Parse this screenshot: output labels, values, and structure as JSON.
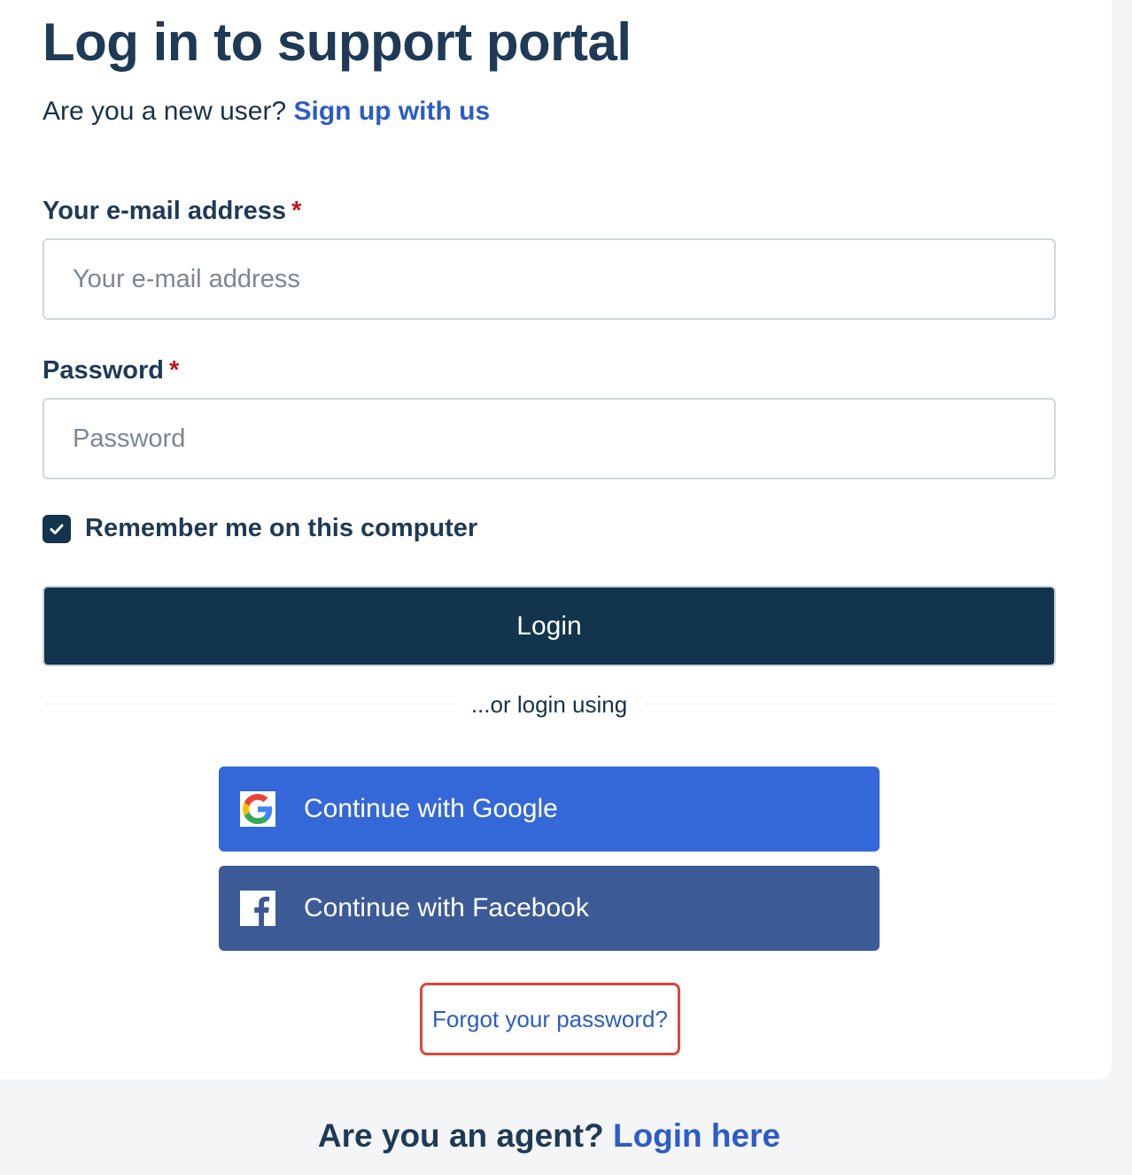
{
  "page": {
    "title": "Log in to support portal",
    "signup_prompt": "Are you a new user?",
    "signup_link": "Sign up with us"
  },
  "form": {
    "email": {
      "label": "Your e-mail address",
      "required_marker": "*",
      "placeholder": "Your e-mail address",
      "value": ""
    },
    "password": {
      "label": "Password",
      "required_marker": "*",
      "placeholder": "Password",
      "value": ""
    },
    "remember": {
      "label": "Remember me on this computer",
      "checked": true
    },
    "login_button": "Login"
  },
  "alt_login": {
    "divider_text": "...or login using",
    "providers": [
      {
        "label": "Continue with Google",
        "icon": "google-icon",
        "color": "#3468d8"
      },
      {
        "label": "Continue with Facebook",
        "icon": "facebook-icon",
        "color": "#3c5a96"
      }
    ]
  },
  "forgot_password": "Forgot your password?",
  "agent": {
    "prompt": "Are you an agent?",
    "link": "Login here"
  },
  "colors": {
    "primary": "#12344d",
    "link": "#2c5cc5",
    "required": "#c0171c",
    "highlight": "#d9473d"
  }
}
